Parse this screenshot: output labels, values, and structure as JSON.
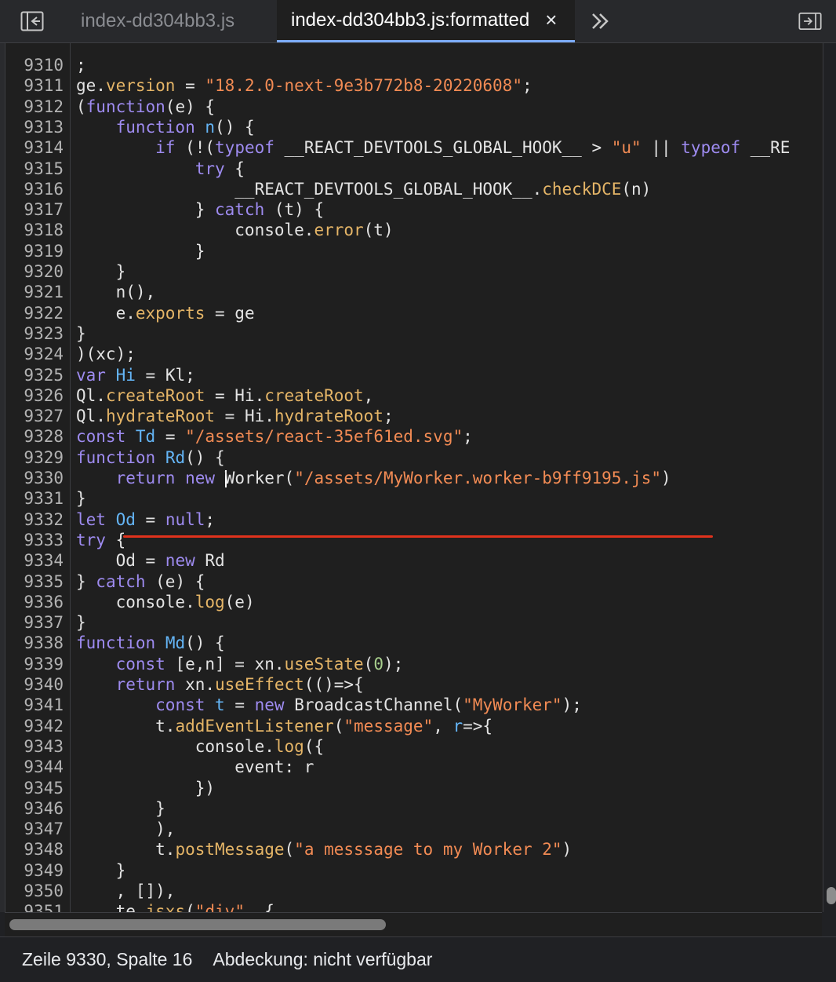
{
  "tabs": {
    "tab1_label": "index-dd304bb3.js",
    "tab2_label": "index-dd304bb3.js:formatted",
    "close_glyph": "×",
    "more_glyph": "»"
  },
  "code_lines": [
    {
      "n": "9310",
      "t": ";"
    },
    {
      "n": "9311",
      "t": "ge.version = \"18.2.0-next-9e3b772b8-20220608\";"
    },
    {
      "n": "9312",
      "t": "(function(e) {"
    },
    {
      "n": "9313",
      "t": "    function n() {"
    },
    {
      "n": "9314",
      "t": "        if (!(typeof __REACT_DEVTOOLS_GLOBAL_HOOK__ > \"u\" || typeof __RE"
    },
    {
      "n": "9315",
      "t": "            try {"
    },
    {
      "n": "9316",
      "t": "                __REACT_DEVTOOLS_GLOBAL_HOOK__.checkDCE(n)"
    },
    {
      "n": "9317",
      "t": "            } catch (t) {"
    },
    {
      "n": "9318",
      "t": "                console.error(t)"
    },
    {
      "n": "9319",
      "t": "            }"
    },
    {
      "n": "9320",
      "t": "    }"
    },
    {
      "n": "9321",
      "t": "    n(),"
    },
    {
      "n": "9322",
      "t": "    e.exports = ge"
    },
    {
      "n": "9323",
      "t": "}"
    },
    {
      "n": "9324",
      "t": ")(xc);"
    },
    {
      "n": "9325",
      "t": "var Hi = Kl;"
    },
    {
      "n": "9326",
      "t": "Ql.createRoot = Hi.createRoot,"
    },
    {
      "n": "9327",
      "t": "Ql.hydrateRoot = Hi.hydrateRoot;"
    },
    {
      "n": "9328",
      "t": "const Td = \"/assets/react-35ef61ed.svg\";"
    },
    {
      "n": "9329",
      "t": "function Rd() {"
    },
    {
      "n": "9330",
      "t": "    return new Worker(\"/assets/MyWorker.worker-b9ff9195.js\")"
    },
    {
      "n": "9331",
      "t": "}"
    },
    {
      "n": "9332",
      "t": "let Od = null;"
    },
    {
      "n": "9333",
      "t": "try {"
    },
    {
      "n": "9334",
      "t": "    Od = new Rd"
    },
    {
      "n": "9335",
      "t": "} catch (e) {"
    },
    {
      "n": "9336",
      "t": "    console.log(e)"
    },
    {
      "n": "9337",
      "t": "}"
    },
    {
      "n": "9338",
      "t": "function Md() {"
    },
    {
      "n": "9339",
      "t": "    const [e,n] = xn.useState(0);"
    },
    {
      "n": "9340",
      "t": "    return xn.useEffect(()=>{"
    },
    {
      "n": "9341",
      "t": "        const t = new BroadcastChannel(\"MyWorker\");"
    },
    {
      "n": "9342",
      "t": "        t.addEventListener(\"message\", r=>{"
    },
    {
      "n": "9343",
      "t": "            console.log({"
    },
    {
      "n": "9344",
      "t": "                event: r"
    },
    {
      "n": "9345",
      "t": "            })"
    },
    {
      "n": "9346",
      "t": "        }"
    },
    {
      "n": "9347",
      "t": "        ),"
    },
    {
      "n": "9348",
      "t": "        t.postMessage(\"a messsage to my Worker 2\")"
    },
    {
      "n": "9349",
      "t": "    }"
    },
    {
      "n": "9350",
      "t": "    , []),"
    },
    {
      "n": "9351",
      "t": "    te.jsxs(\"div\", {"
    }
  ],
  "status": {
    "position": "Zeile 9330, Spalte 16",
    "coverage": "Abdeckung: nicht verfügbar"
  },
  "colors": {
    "keyword": "#9e8bf0",
    "function": "#64b5f6",
    "string": "#f28b54",
    "property": "#e5b567",
    "annotation_underline": "#e0321c",
    "active_tab_indicator": "#7cacf8"
  }
}
